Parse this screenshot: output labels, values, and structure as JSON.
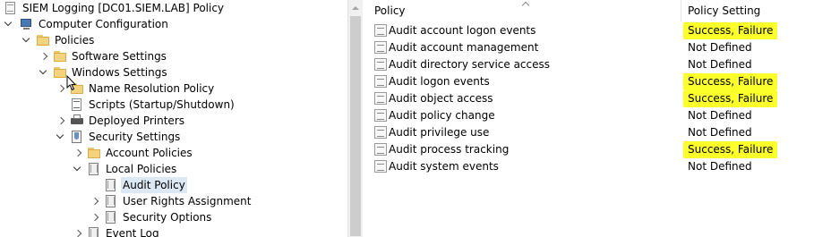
{
  "tree": {
    "nodes": [
      {
        "key": "root",
        "label": "SIEM Logging [DC01.SIEM.LAB] Policy",
        "icon": "policy-scroll-icon"
      },
      {
        "key": "computer_config",
        "label": "Computer Configuration",
        "icon": "computer-icon"
      },
      {
        "key": "policies",
        "label": "Policies",
        "icon": "folder-icon"
      },
      {
        "key": "software_settings",
        "label": "Software Settings",
        "icon": "folder-icon"
      },
      {
        "key": "windows_settings",
        "label": "Windows Settings",
        "icon": "folder-icon"
      },
      {
        "key": "name_resolution",
        "label": "Name Resolution Policy",
        "icon": "folder-icon"
      },
      {
        "key": "scripts",
        "label": "Scripts (Startup/Shutdown)",
        "icon": "script-icon"
      },
      {
        "key": "printers",
        "label": "Deployed Printers",
        "icon": "printer-icon"
      },
      {
        "key": "security_settings",
        "label": "Security Settings",
        "icon": "security-settings-icon"
      },
      {
        "key": "account_policies",
        "label": "Account Policies",
        "icon": "folder-icon"
      },
      {
        "key": "local_policies",
        "label": "Local Policies",
        "icon": "policy-book-icon"
      },
      {
        "key": "audit_policy",
        "label": "Audit Policy",
        "icon": "policy-book-icon"
      },
      {
        "key": "user_rights",
        "label": "User Rights Assignment",
        "icon": "policy-book-icon"
      },
      {
        "key": "security_options",
        "label": "Security Options",
        "icon": "policy-book-icon"
      },
      {
        "key": "event_log",
        "label": "Event Log",
        "icon": "policy-book-icon"
      }
    ],
    "selected": "Audit Policy"
  },
  "list": {
    "columns": {
      "policy": "Policy",
      "setting": "Policy Setting"
    },
    "rows": [
      {
        "policy": "Audit account logon events",
        "setting": "Success, Failure",
        "highlight": true
      },
      {
        "policy": "Audit account management",
        "setting": "Not Defined",
        "highlight": false
      },
      {
        "policy": "Audit directory service access",
        "setting": "Not Defined",
        "highlight": false
      },
      {
        "policy": "Audit logon events",
        "setting": "Success, Failure",
        "highlight": true
      },
      {
        "policy": "Audit object access",
        "setting": "Success, Failure",
        "highlight": true
      },
      {
        "policy": "Audit policy change",
        "setting": "Not Defined",
        "highlight": false
      },
      {
        "policy": "Audit privilege use",
        "setting": "Not Defined",
        "highlight": false
      },
      {
        "policy": "Audit process tracking",
        "setting": "Success, Failure",
        "highlight": true
      },
      {
        "policy": "Audit system events",
        "setting": "Not Defined",
        "highlight": false
      }
    ]
  },
  "colors": {
    "highlight": "#fbff2a",
    "selection": "#dde8f5"
  }
}
